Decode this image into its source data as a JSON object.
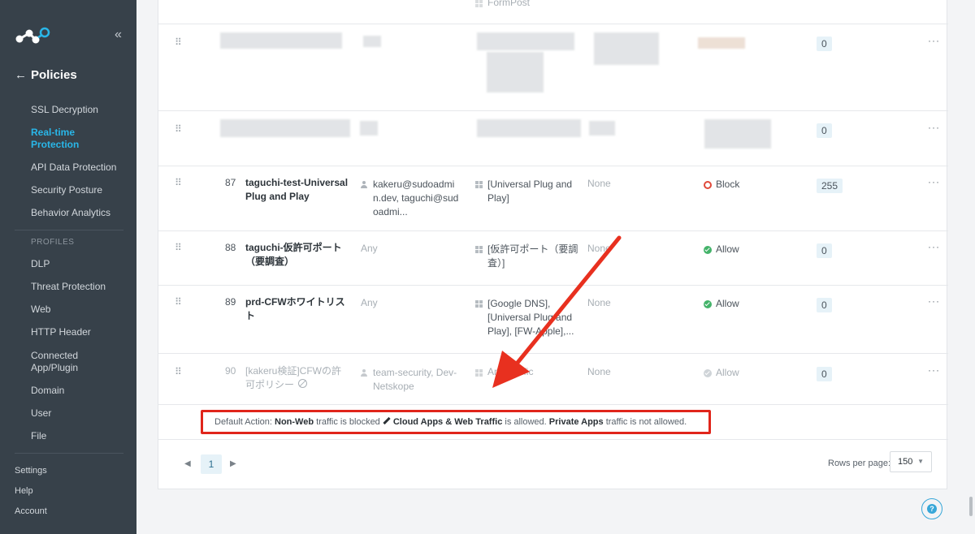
{
  "sidebar": {
    "collapse_glyph": "«",
    "back_glyph": "←",
    "section_title": "Policies",
    "items": [
      {
        "label": "SSL Decryption"
      },
      {
        "label": "Real-time Protection"
      },
      {
        "label": "API Data Protection"
      },
      {
        "label": "Security Posture"
      },
      {
        "label": "Behavior Analytics"
      }
    ],
    "profiles_heading": "PROFILES",
    "profiles": [
      {
        "label": "DLP"
      },
      {
        "label": "Threat Protection"
      },
      {
        "label": "Web"
      },
      {
        "label": "HTTP Header"
      },
      {
        "label": "Connected App/Plugin"
      },
      {
        "label": "Domain"
      },
      {
        "label": "User"
      },
      {
        "label": "File"
      }
    ],
    "bottom": [
      {
        "label": "Settings"
      },
      {
        "label": "Help"
      },
      {
        "label": "Account"
      }
    ]
  },
  "table": {
    "partial_top_text": "FormPost",
    "blurred_counts": [
      "0",
      "0"
    ],
    "rows": [
      {
        "num": "87",
        "name": "taguchi-test-Universal Plug and Play",
        "source": "kakeru@sudoadmin.dev, taguchi@sudoadmi...",
        "destination": "[Universal Plug and Play]",
        "profile": "None",
        "action": "Block",
        "count": "255"
      },
      {
        "num": "88",
        "name": "taguchi-仮許可ポート（要調査）",
        "source": "Any",
        "destination": "[仮許可ポート（要調査）]",
        "profile": "None",
        "action": "Allow",
        "count": "0"
      },
      {
        "num": "89",
        "name": "prd-CFWホワイトリスト",
        "source": "Any",
        "destination": "[Google DNS], [Universal Plug and Play], [FW-Apple],...",
        "profile": "None",
        "action": "Allow",
        "count": "0"
      },
      {
        "num": "90",
        "name": "[kakeru検証]CFWの許可ポリシー",
        "source": "team-security, Dev-Netskope",
        "destination": "Any Traffic",
        "profile": "None",
        "action": "Allow",
        "count": "0"
      }
    ],
    "row_menu": "···"
  },
  "default_action": {
    "prefix": "Default Action: ",
    "nonweb": "Non-Web",
    "nonweb_rest": " traffic is blocked ",
    "cloud": "Cloud Apps & Web Traffic",
    "cloud_rest": " is allowed. ",
    "private": "Private Apps",
    "private_rest": " traffic is not allowed."
  },
  "pagination": {
    "prev": "◀",
    "current": "1",
    "next": "▶",
    "rows_per_page_label": "Rows per page:",
    "rows_per_page": "150"
  },
  "help_glyph": "?",
  "colors": {
    "sidebar_bg": "#37414a",
    "accent": "#29b6e8",
    "block": "#e0493a",
    "allow": "#44b36a",
    "highlight": "#e0251b"
  }
}
